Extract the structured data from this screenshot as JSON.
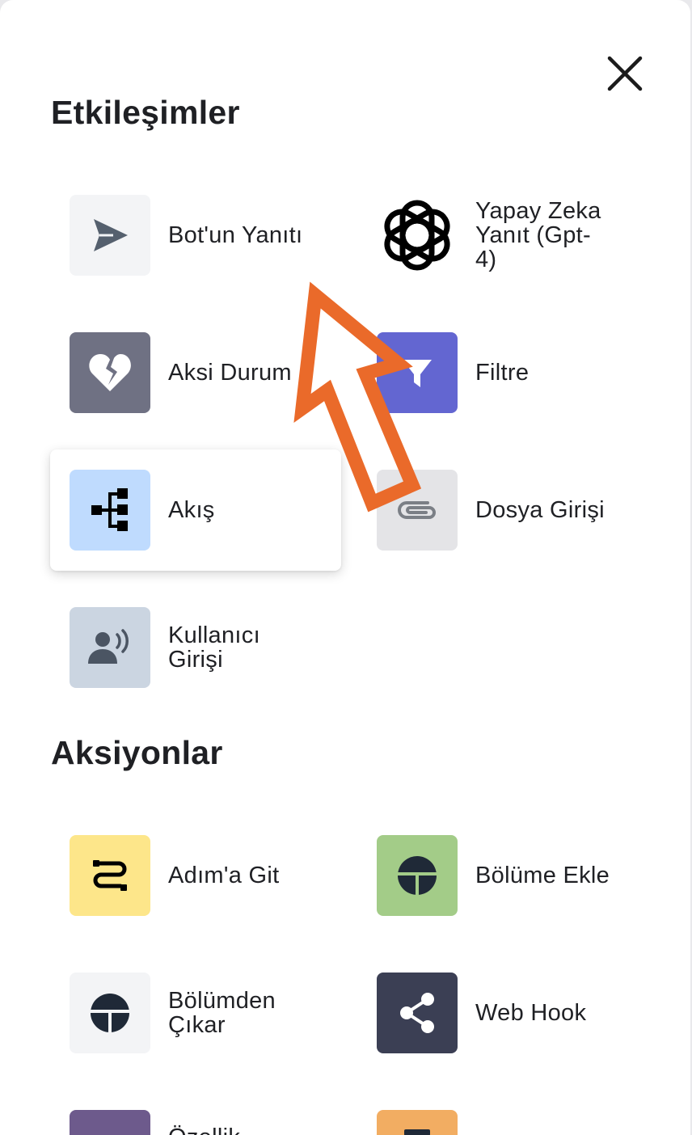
{
  "close": {
    "icon": "close-icon"
  },
  "sections": {
    "interactions_title": "Etkileşimler",
    "actions_title": "Aksiyonlar"
  },
  "interactions": [
    {
      "label": "Bot'un Yanıtı",
      "icon": "send-icon",
      "tile_color": "#f3f4f6"
    },
    {
      "label": "Yapay Zeka\nYanıt (Gpt-\n4)",
      "icon": "openai-logo-icon",
      "tile_color": "#ffffff"
    },
    {
      "label": "Aksi Durum",
      "icon": "broken-heart-icon",
      "tile_color": "#6f7183"
    },
    {
      "label": "Filtre",
      "icon": "filter-icon",
      "tile_color": "#6366d1"
    },
    {
      "label": "Akış",
      "icon": "flow-tree-icon",
      "tile_color": "#bfdbfe"
    },
    {
      "label": "Dosya Girişi",
      "icon": "paperclip-icon",
      "tile_color": "#e4e4e7"
    },
    {
      "label": "Kullanıcı\nGirişi",
      "icon": "user-voice-icon",
      "tile_color": "#cbd5e1"
    }
  ],
  "actions": [
    {
      "label": "Adım'a Git",
      "icon": "route-icon",
      "tile_color": "#fde68a"
    },
    {
      "label": "Bölüme Ekle",
      "icon": "section-add-icon",
      "tile_color": "#a3cc88"
    },
    {
      "label": "Bölümden\nÇıkar",
      "icon": "section-remove-icon",
      "tile_color": "#f3f4f6"
    },
    {
      "label": "Web Hook",
      "icon": "share-icon",
      "tile_color": "#3b3f54"
    },
    {
      "label": "Özellik",
      "icon": "property-icon",
      "tile_color": "#6d5a8c"
    },
    {
      "label": "",
      "icon": "tag-icon",
      "tile_color": "#f2ad62"
    }
  ],
  "annotation": {
    "icon": "arrow-pointer-icon",
    "color": "#ea6a2a"
  }
}
